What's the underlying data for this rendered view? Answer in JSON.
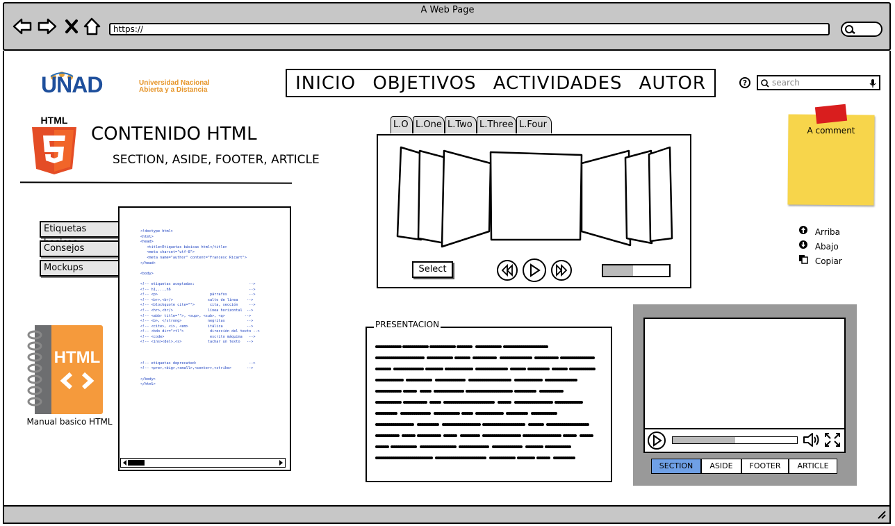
{
  "window": {
    "title": "A Web Page",
    "url": "https://"
  },
  "search": {
    "placeholder": "search"
  },
  "logo": {
    "text": "UNAD",
    "tagline_line1": "Universidad Nacional",
    "tagline_line2": "Abierta y a Distancia"
  },
  "menu": {
    "items": [
      "INICIO",
      "OBJETIVOS",
      "ACTIVIDADES",
      "AUTOR"
    ]
  },
  "content": {
    "html5_badge": "HTML",
    "title": "CONTENIDO HTML",
    "subtitle": "SECTION, ASIDE, FOOTER, ARTICLE"
  },
  "side_tabs": [
    "Etiquetas basicas",
    "Consejos",
    "Mockups"
  ],
  "manual": {
    "badge": "HTML",
    "label": "Manual basico HTML"
  },
  "carousel_tabs": [
    "L.O",
    "L.One",
    "L.Two",
    "L.Three",
    "L.Four"
  ],
  "carousel": {
    "select_label": "Select",
    "progress": 0.45
  },
  "presentation": {
    "label": "PRESENTACION"
  },
  "video": {
    "progress": 0.5,
    "tabs": [
      "SECTION",
      "ASIDE",
      "FOOTER",
      "ARTICLE"
    ],
    "active_tab": "SECTION"
  },
  "note": {
    "text": "A comment"
  },
  "side_links": [
    "Arriba",
    "Abajo",
    "Copiar"
  ],
  "colors": {
    "chrome": "#c7c7c7",
    "note": "#f7d54b",
    "tape": "#d91e1e",
    "html5": "#e44d26",
    "active_tab": "#6fa0e6"
  },
  "icons": [
    "back-icon",
    "forward-icon",
    "close-icon",
    "home-icon",
    "search-icon",
    "help-icon",
    "mic-icon",
    "rewind-icon",
    "play-icon",
    "fast-forward-icon",
    "volume-icon",
    "fullscreen-icon",
    "arrow-up-icon",
    "arrow-down-icon",
    "copy-icon",
    "resize-icon"
  ]
}
